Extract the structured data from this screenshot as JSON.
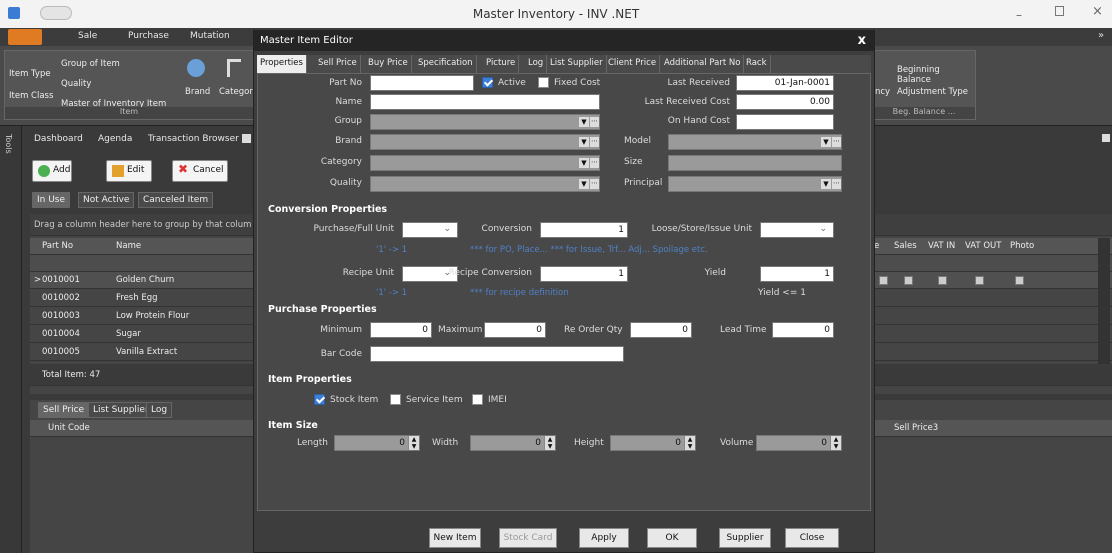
{
  "window": {
    "title": "Master Inventory - INV .NET"
  },
  "ribbon_tabs": [
    "Sale",
    "Purchase",
    "Mutation"
  ],
  "ribbon": {
    "item_type": "Item Type",
    "item_class": "Item Class",
    "group_of_item": "Group of Item",
    "quality": "Quality",
    "master_of_inventory": "Master of Inventory Item",
    "brand": "Brand",
    "category": "Categor",
    "group_label": "Item",
    "ncy": "ncy",
    "beginning_balance": "Beginning Balance",
    "adjustment_type": "Adjustment Type",
    "beg_balance_group": "Beg. Balance ..."
  },
  "tools_label": "Tools",
  "doc_tabs": [
    "Dashboard",
    "Agenda",
    "Transaction Browser"
  ],
  "toolbar": {
    "add": "Add",
    "edit": "Edit",
    "cancel": "Cancel"
  },
  "sub_tabs": [
    "In Use",
    "Not Active",
    "Canceled Item"
  ],
  "grid": {
    "group_hint": "Drag a column header here to group by that colum",
    "columns": [
      "Part No",
      "Name"
    ],
    "right_columns": [
      "e",
      "Sales",
      "VAT IN",
      "VAT OUT",
      "Photo"
    ],
    "rows": [
      {
        "part_no": "0010001",
        "name": "Golden Churn"
      },
      {
        "part_no": "0010002",
        "name": "Fresh Egg"
      },
      {
        "part_no": "0010003",
        "name": "Low Protein Flour"
      },
      {
        "part_no": "0010004",
        "name": "Sugar"
      },
      {
        "part_no": "0010005",
        "name": "Vanilla Extract"
      }
    ],
    "total": "Total Item: 47"
  },
  "detail": {
    "tabs": [
      "Sell Price",
      "List Supplier",
      "Log"
    ],
    "col": "Unit Code",
    "col_right": "Sell Price3"
  },
  "dialog": {
    "title": "Master Item Editor",
    "close": "x",
    "tabs": [
      "Properties",
      "Sell Price",
      "Buy Price",
      "Specification",
      "Picture",
      "Log",
      "List Supplier",
      "Client Price",
      "Additional Part No",
      "Rack"
    ],
    "fields": {
      "part_no": "Part No",
      "active": "Active",
      "fixed_cost": "Fixed Cost",
      "name": "Name",
      "group": "Group",
      "brand": "Brand",
      "category": "Category",
      "quality": "Quality",
      "last_received": "Last Received",
      "last_received_value": "01-Jan-0001",
      "last_received_cost": "Last Received Cost",
      "last_received_cost_value": "0.00",
      "on_hand_cost": "On Hand Cost",
      "model": "Model",
      "size": "Size",
      "principal": "Principal"
    },
    "conversion": {
      "title": "Conversion Properties",
      "purchase_unit": "Purchase/Full Unit",
      "conversion": "Conversion",
      "conversion_value": "1",
      "loose_unit": "Loose/Store/Issue Unit",
      "note1": "'1' -> 1",
      "note2": "*** for PO, Place... *** for Issue, Trf... Adj... Spoilage etc.",
      "recipe_unit": "Recipe Unit",
      "recipe_conversion": "Recipe Conversion",
      "recipe_conversion_value": "1",
      "yield": "Yield",
      "yield_value": "1",
      "note3": "'1' -> 1",
      "note4": "*** for recipe definition",
      "yield_note": "Yield <= 1"
    },
    "purchase": {
      "title": "Purchase Properties",
      "minimum": "Minimum",
      "minimum_value": "0",
      "maximum": "Maximum",
      "maximum_value": "0",
      "reorder": "Re Order Qty",
      "reorder_value": "0",
      "lead_time": "Lead Time",
      "lead_time_value": "0",
      "bar_code": "Bar Code"
    },
    "item_props": {
      "title": "Item Properties",
      "stock_item": "Stock Item",
      "service_item": "Service Item",
      "imei": "IMEI"
    },
    "item_size": {
      "title": "Item Size",
      "length": "Length",
      "length_value": "0",
      "width": "Width",
      "width_value": "0",
      "height": "Height",
      "height_value": "0",
      "volume": "Volume",
      "volume_value": "0"
    },
    "buttons": {
      "new_item": "New Item",
      "stock_card": "Stock Card",
      "apply": "Apply",
      "ok": "OK",
      "supplier": "Supplier",
      "close": "Close"
    }
  }
}
